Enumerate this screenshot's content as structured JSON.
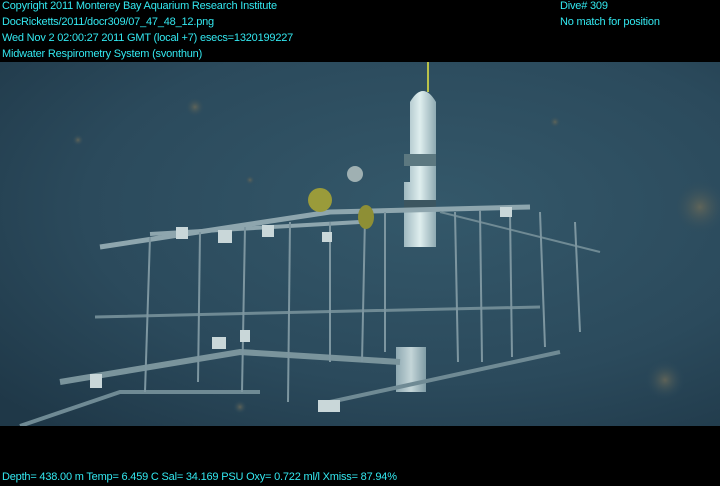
{
  "overlay": {
    "header_left": [
      "Copyright 2011 Monterey Bay Aquarium Research Institute",
      "DocRicketts/2011/docr309/07_47_48_12.png",
      "Wed Nov  2 02:00:27 2011 GMT (local +7)  esecs=1320199227",
      "Midwater Respirometry System (svonthun)"
    ],
    "header_right": [
      "Dive# 309",
      "No match for position"
    ],
    "footer": "Depth= 438.00 m  Temp= 6.459 C  Sal= 34.169 PSU  Oxy= 0.722 ml/l  Xmiss= 87.94%"
  },
  "colors": {
    "overlay_text": "#33e8f0",
    "water": "#2b4a5c",
    "background": "#000000"
  },
  "scene": {
    "subject": "underwater respirometry frame with cylindrical float",
    "icon": "underwater-photo"
  }
}
